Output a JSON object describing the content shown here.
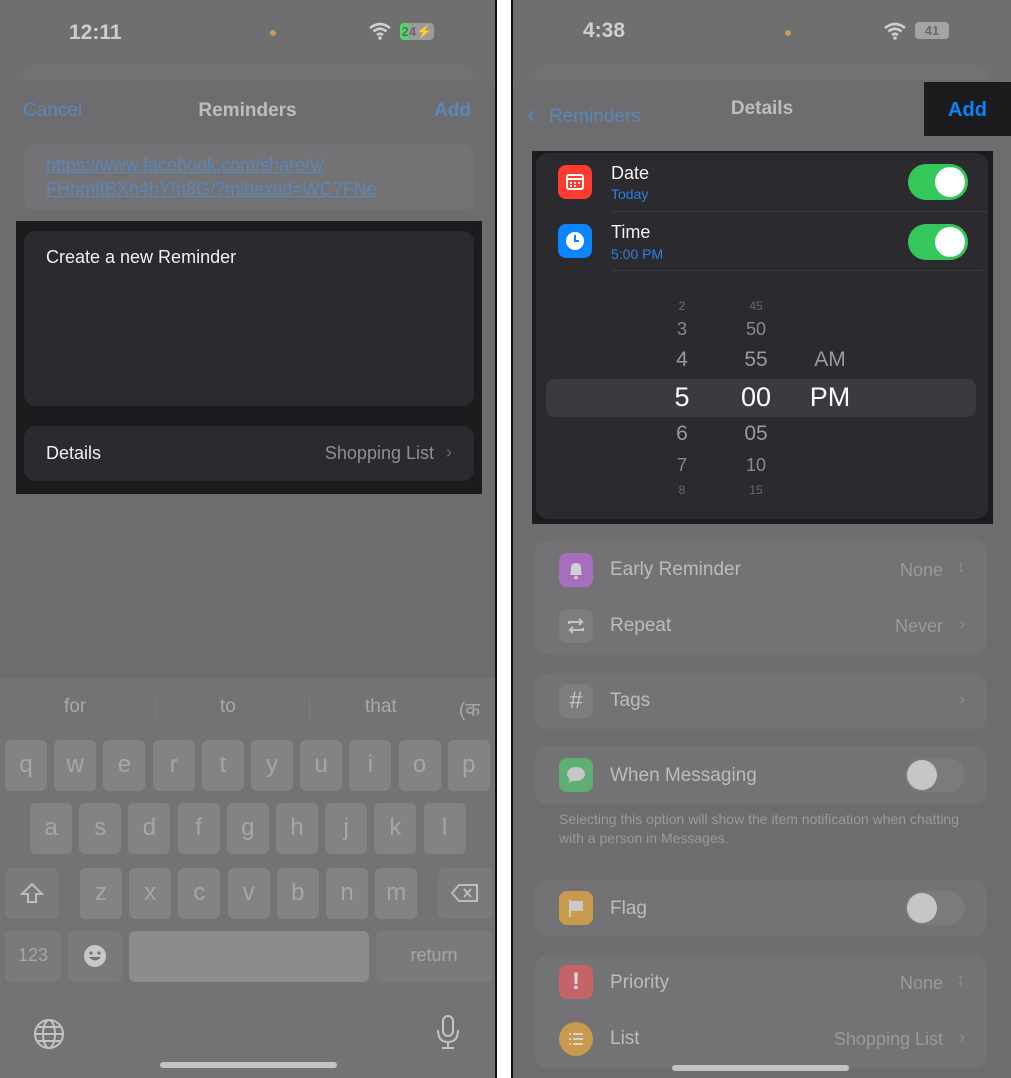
{
  "left": {
    "status": {
      "time": "12:11",
      "battery": "24",
      "battery_charging": true,
      "battery_color": "#4cd964"
    },
    "nav": {
      "cancel": "Cancel",
      "title": "Reminders",
      "add": "Add"
    },
    "url": {
      "line1": "https://www.facebook.com/share/v/",
      "line2": "FHhmItBXh4hYIh8G/?mibextid=WC7FNe"
    },
    "reminder_text": "Create a new Reminder",
    "details": {
      "label": "Details",
      "value": "Shopping List"
    },
    "keyboard": {
      "suggestions": [
        "for",
        "to",
        "that",
        "(क"
      ],
      "row1": [
        "q",
        "w",
        "e",
        "r",
        "t",
        "y",
        "u",
        "i",
        "o",
        "p"
      ],
      "row2": [
        "a",
        "s",
        "d",
        "f",
        "g",
        "h",
        "j",
        "k",
        "l"
      ],
      "row3": [
        "z",
        "x",
        "c",
        "v",
        "b",
        "n",
        "m"
      ],
      "numbers_key": "123",
      "return_key": "return"
    }
  },
  "right": {
    "status": {
      "time": "4:38",
      "battery": "41"
    },
    "nav": {
      "back": "Reminders",
      "title": "Details",
      "add": "Add"
    },
    "date": {
      "label": "Date",
      "value": "Today",
      "enabled": true
    },
    "time": {
      "label": "Time",
      "value": "5:00 PM",
      "enabled": true
    },
    "picker": {
      "hours": [
        "2",
        "3",
        "4",
        "5",
        "6",
        "7",
        "8"
      ],
      "minutes": [
        "45",
        "50",
        "55",
        "00",
        "05",
        "10",
        "15"
      ],
      "periods": [
        "AM",
        "PM"
      ],
      "selected": {
        "hour": "5",
        "minute": "00",
        "period": "PM"
      }
    },
    "early_reminder": {
      "label": "Early Reminder",
      "value": "None"
    },
    "repeat": {
      "label": "Repeat",
      "value": "Never"
    },
    "tags": {
      "label": "Tags"
    },
    "when_messaging": {
      "label": "When Messaging",
      "enabled": false,
      "footnote": "Selecting this option will show the item notification when chatting with a person in Messages."
    },
    "flag": {
      "label": "Flag",
      "enabled": false
    },
    "priority": {
      "label": "Priority",
      "value": "None"
    },
    "list": {
      "label": "List",
      "value": "Shopping List"
    },
    "colors": {
      "accent": "#0a84ff",
      "toggle_on": "#34c759",
      "date_icon": "#ff3b30",
      "time_icon": "#0a84ff"
    }
  }
}
